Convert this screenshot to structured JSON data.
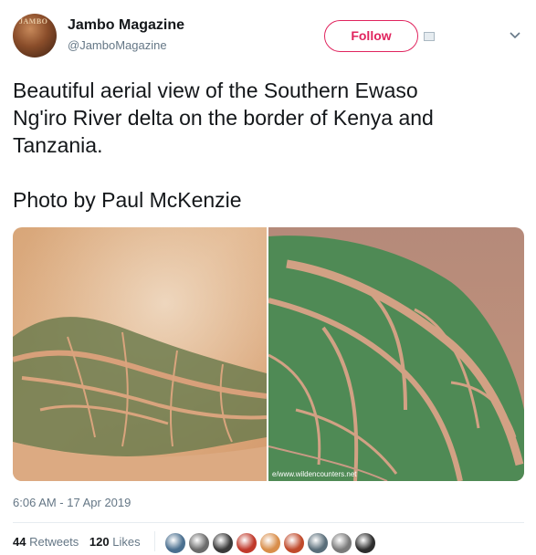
{
  "account": {
    "name": "Jambo Magazine",
    "handle": "@JamboMagazine",
    "avatar_text": "JAMBO"
  },
  "follow_label": "Follow",
  "tweet": {
    "text": "Beautiful aerial view of the Southern Ewaso\nNg'iro River delta on the border of Kenya and\nTanzania.\n\nPhoto by Paul McKenzie"
  },
  "photos": {
    "watermark": "e/www.wildencounters.net"
  },
  "timestamp": "6:06 AM - 17 Apr 2019",
  "stats": {
    "retweets_count": "44",
    "retweets_label": "Retweets",
    "likes_count": "120",
    "likes_label": "Likes"
  },
  "colors": {
    "follow": "#e0245e",
    "secondary_text": "#657786",
    "primary_text": "#14171a"
  },
  "likers": [
    {
      "color": "#4a6f8f"
    },
    {
      "color": "#6b6b6b"
    },
    {
      "color": "#3a3a3a"
    },
    {
      "color": "#c0392b"
    },
    {
      "color": "#d98e4a"
    },
    {
      "color": "#c04a2b"
    },
    {
      "color": "#5a6e7a"
    },
    {
      "color": "#7a7a7a"
    },
    {
      "color": "#2d2d2d"
    }
  ]
}
